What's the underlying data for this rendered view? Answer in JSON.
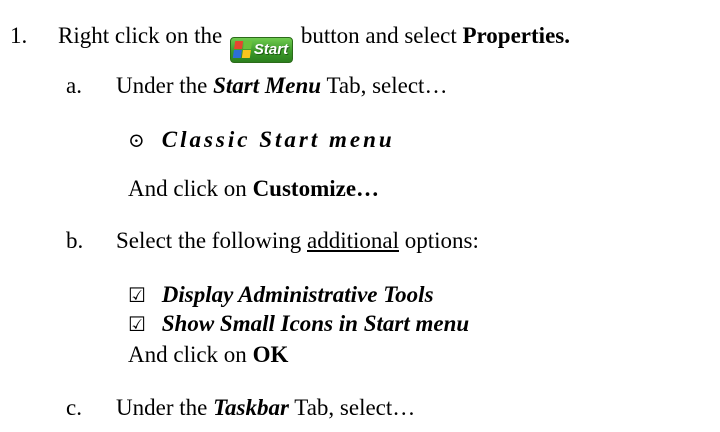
{
  "step1": {
    "number": "1.",
    "text_before": "Right click on the",
    "start_button_label": "Start",
    "text_after": "button and select",
    "emphasis": "Properties."
  },
  "step_a": {
    "letter": "a.",
    "text_before": "Under the",
    "tab_name": "Start Menu",
    "text_after": "Tab, select…",
    "radio_glyph": "⊙",
    "option": "Classic Start menu",
    "action_before": "And click on",
    "action_button": "Customize…"
  },
  "step_b": {
    "letter": "b.",
    "text_before": "Select the following",
    "underlined": "additional",
    "text_after": "options:",
    "check_glyph": "☑",
    "options": [
      "Display Administrative Tools",
      "Show Small Icons in Start menu"
    ],
    "action_before": "And click on",
    "action_button": "OK"
  },
  "step_c": {
    "letter": "c.",
    "text_before": "Under the",
    "tab_name": "Taskbar",
    "text_after": "Tab, select…"
  }
}
